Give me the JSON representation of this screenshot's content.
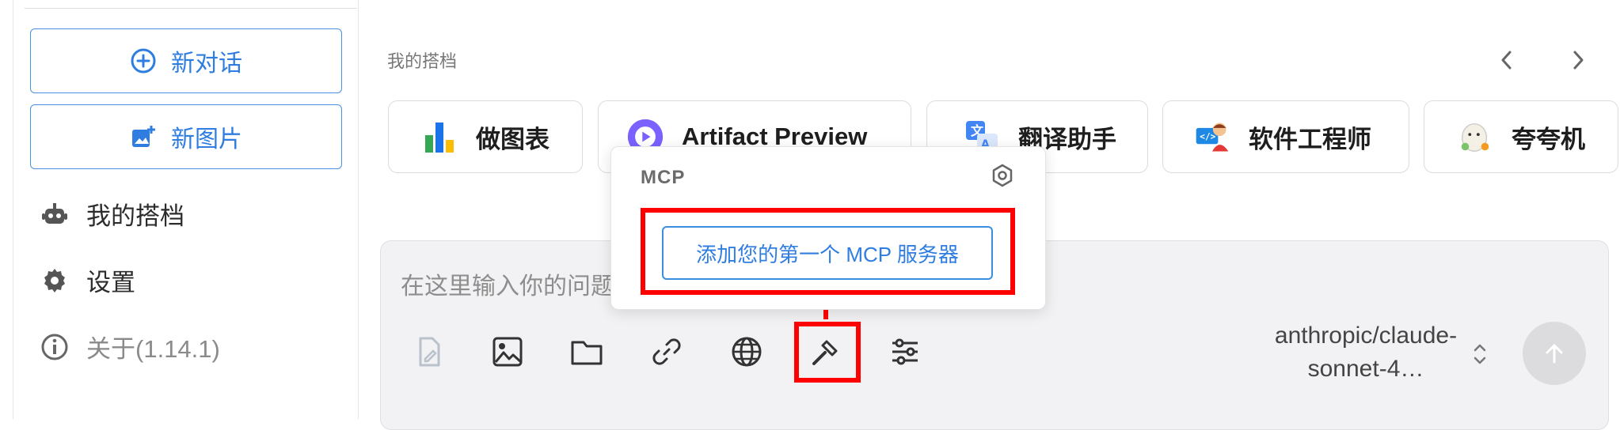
{
  "sidebar": {
    "new_chat_label": "新对话",
    "new_image_label": "新图片",
    "items": [
      {
        "label": "我的搭档",
        "icon": "robot-icon"
      },
      {
        "label": "设置",
        "icon": "gear-icon"
      },
      {
        "label": "关于(1.14.1)",
        "icon": "info-icon"
      }
    ]
  },
  "main": {
    "section_title": "我的搭档",
    "cards": [
      {
        "label": "做图表",
        "icon": "chart-icon"
      },
      {
        "label": "Artifact Preview",
        "icon": "play-icon"
      },
      {
        "label": "翻译助手",
        "icon": "translate-icon"
      },
      {
        "label": "软件工程师",
        "icon": "engineer-icon"
      },
      {
        "label": "夸夸机",
        "icon": "cheer-icon"
      }
    ],
    "input": {
      "placeholder": "在这里输入你的问题"
    },
    "toolbar": [
      {
        "name": "file-icon",
        "active": false
      },
      {
        "name": "image-icon",
        "active": true
      },
      {
        "name": "folder-icon",
        "active": true
      },
      {
        "name": "link-icon",
        "active": true
      },
      {
        "name": "globe-icon",
        "active": true
      },
      {
        "name": "hammer-icon",
        "active": true,
        "highlighted": true
      },
      {
        "name": "sliders-icon",
        "active": true
      }
    ],
    "model": {
      "line1": "anthropic/claude-",
      "line2": "sonnet-4…"
    }
  },
  "popover": {
    "title": "MCP",
    "add_server_label": "添加您的第一个 MCP 服务器"
  },
  "colors": {
    "accent": "#2f7de1",
    "highlight": "#ff0000",
    "panel_bg": "#f2f2f4"
  }
}
